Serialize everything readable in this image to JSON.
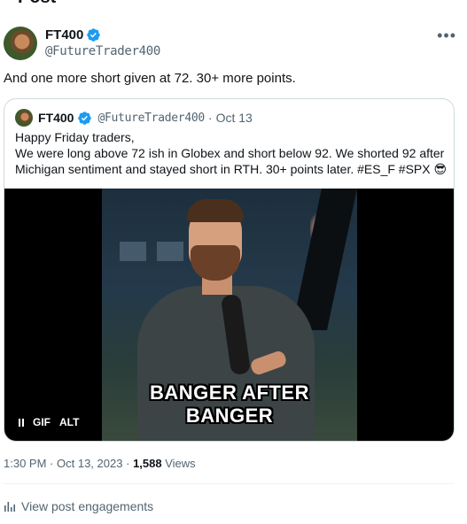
{
  "header": {
    "title": "Post"
  },
  "post": {
    "author": {
      "name": "FT400",
      "handle": "@FutureTrader400"
    },
    "text": "And one more short given at 72. 30+ more points.",
    "quote": {
      "author": {
        "name": "FT400",
        "handle": "@FutureTrader400"
      },
      "separator": "·",
      "date": "Oct 13",
      "lines": [
        "Happy Friday traders,",
        "We were long above 72 ish in Globex and short below 92. We shorted 92 after",
        "Michigan sentiment and stayed short in RTH.  30+ points later. #ES_F #SPX 😎"
      ],
      "media": {
        "caption_line1": "BANGER AFTER",
        "caption_line2": "BANGER",
        "gif_label": "GIF",
        "alt_label": "ALT"
      }
    },
    "meta": {
      "time": "1:30 PM",
      "separator": "·",
      "date": "Oct 13, 2023",
      "views_count": "1,588",
      "views_label": "Views"
    },
    "engagements_label": "View post engagements"
  },
  "colors": {
    "accent": "#1d9bf0",
    "text": "#0f1419",
    "secondary": "#536471",
    "border": "#cfd9de"
  },
  "icons": [
    "verified-badge-icon",
    "more-options-icon",
    "pause-icon",
    "analytics-icon"
  ]
}
